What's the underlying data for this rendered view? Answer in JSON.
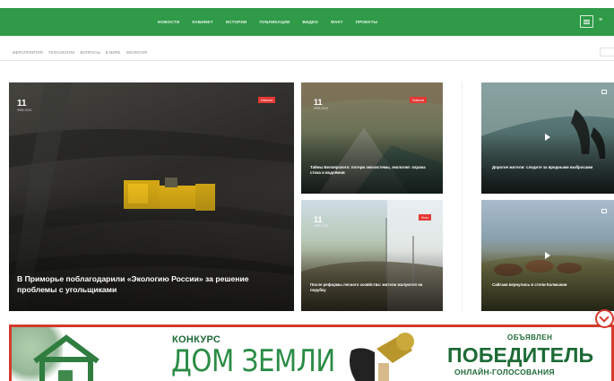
{
  "nav": {
    "items": [
      {
        "label": "НОВОСТИ"
      },
      {
        "label": "КАБИНЕТ"
      },
      {
        "label": "ИСТОРИИ"
      },
      {
        "label": "ПУБЛИКАЦИИ"
      },
      {
        "label": "ВИДЕО"
      },
      {
        "label": "ФАКТ"
      },
      {
        "label": "ПРОЕКТЫ"
      }
    ],
    "extra": "≡"
  },
  "subnav": {
    "tags": [
      {
        "label": "МЕРОПРИЯТИЯ"
      },
      {
        "label": "ТЕХНОЛОГИИ"
      },
      {
        "label": "ВОПРОСЫ"
      },
      {
        "label": "В МИРЕ"
      },
      {
        "label": "ЭКОЛОГИЯ"
      }
    ]
  },
  "cards": {
    "c1": {
      "day": "11",
      "month": "ФЕВ 2021",
      "badge": "Новости",
      "title": "В Приморье поблагодарили «Экологию России» за решение проблемы с угольщиками"
    },
    "c2": {
      "day": "11",
      "month": "ФЕВ 2021",
      "badge": "Новости",
      "title": "Тайны Белоярского: потери экосистемы, экология: охрана стока и водоёмов"
    },
    "c3": {
      "day": "11",
      "month": "ФЕВ 2021",
      "badge": "Фото",
      "title": "После реформы лесного хозяйства: жители жалуются на порубку"
    },
    "c4": {
      "title": "Дорогие жители: следите за вредными выбросами"
    },
    "c5": {
      "title": "Сайгаки вернулись в степи Калмыкии"
    }
  },
  "banner": {
    "konkurs": "КОНКУРС",
    "dom": "ДОМ ЗЕМЛИ",
    "announced": "ОБЪЯВЛЕН",
    "winner": "ПОБЕДИТЕЛЬ",
    "vote": "ОНЛАЙН-ГОЛОСОВАНИЯ"
  },
  "colors": {
    "brand_green": "#2f9a47",
    "badge_red": "#e53935",
    "banner_border": "#d23a2c",
    "banner_text": "#1d6a36"
  }
}
